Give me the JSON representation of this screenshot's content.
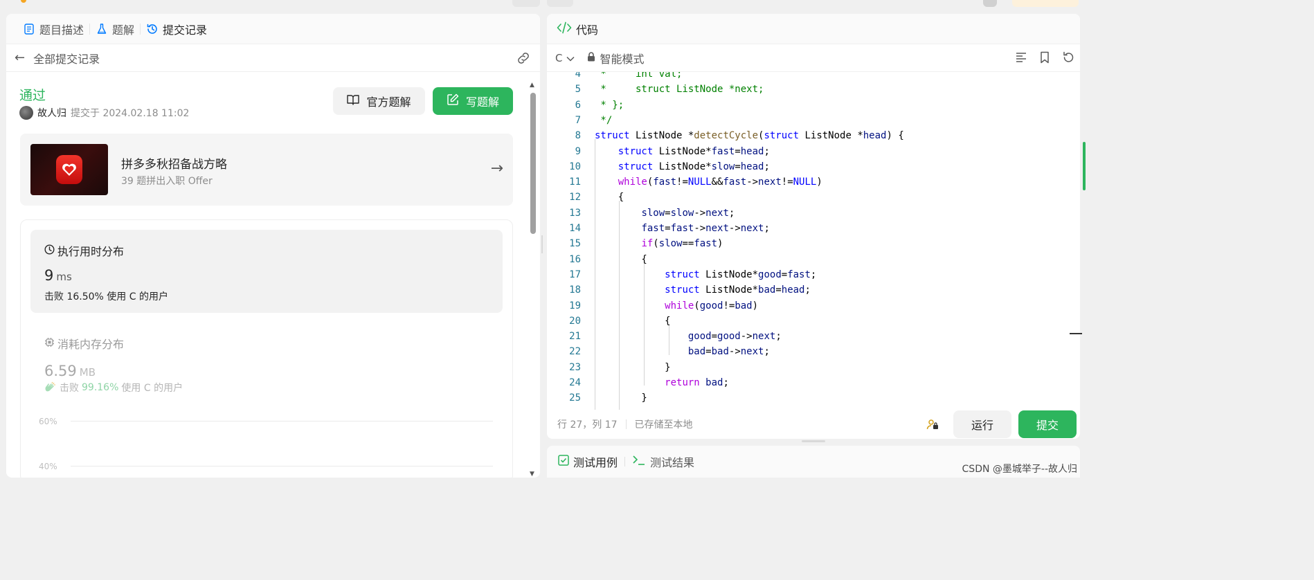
{
  "colors": {
    "accent_green": "#2db55d",
    "link_blue": "#007aff",
    "keyword_blue": "#0000ff",
    "keyword_purple": "#af00db",
    "line_number": "#237893"
  },
  "left_tabs": [
    {
      "label": "题目描述",
      "icon": "document-icon"
    },
    {
      "label": "题解",
      "icon": "flask-icon"
    },
    {
      "label": "提交记录",
      "icon": "history-icon"
    }
  ],
  "subheader": {
    "title": "全部提交记录",
    "back_icon": "arrow-left-icon",
    "share_icon": "link-icon"
  },
  "submission": {
    "status": "通过",
    "user": "故人归",
    "submitted_text": "提交于 2024.02.18 11:02",
    "official_solution_label": "官方题解",
    "write_solution_label": "写题解"
  },
  "promo": {
    "title": "拼多多秋招备战方略",
    "subtitle": "39 题拼出入职 Offer"
  },
  "runtime": {
    "title": "执行用时分布",
    "value": "9",
    "unit": "ms",
    "beats_prefix": "击败",
    "beats_pct": "16.50%",
    "beats_suffix": "使用 C 的用户"
  },
  "memory": {
    "title": "消耗内存分布",
    "value": "6.59",
    "unit": "MB",
    "beats_prefix": "击败",
    "beats_pct": "99.16%",
    "beats_suffix": "使用 C 的用户"
  },
  "chart_labels": [
    "60%",
    "40%"
  ],
  "editor_header": {
    "title": "代码",
    "language": "C",
    "mode": "智能模式"
  },
  "code_lines": [
    {
      "n": "4",
      "t": " *     int val;"
    },
    {
      "n": "5",
      "t": " *     struct ListNode *next;"
    },
    {
      "n": "6",
      "t": " * };"
    },
    {
      "n": "7",
      "t": " */"
    },
    {
      "n": "8",
      "t": "struct ListNode *detectCycle(struct ListNode *head) {"
    },
    {
      "n": "9",
      "t": "    struct ListNode*fast=head;"
    },
    {
      "n": "10",
      "t": "    struct ListNode*slow=head;"
    },
    {
      "n": "11",
      "t": "    while(fast!=NULL&&fast->next!=NULL)"
    },
    {
      "n": "12",
      "t": "    {"
    },
    {
      "n": "13",
      "t": "        slow=slow->next;"
    },
    {
      "n": "14",
      "t": "        fast=fast->next->next;"
    },
    {
      "n": "15",
      "t": "        if(slow==fast)"
    },
    {
      "n": "16",
      "t": "        {"
    },
    {
      "n": "17",
      "t": "            struct ListNode*good=fast;"
    },
    {
      "n": "18",
      "t": "            struct ListNode*bad=head;"
    },
    {
      "n": "19",
      "t": "            while(good!=bad)"
    },
    {
      "n": "20",
      "t": "            {"
    },
    {
      "n": "21",
      "t": "                good=good->next;"
    },
    {
      "n": "22",
      "t": "                bad=bad->next;"
    },
    {
      "n": "23",
      "t": "            }"
    },
    {
      "n": "24",
      "t": "            return bad;"
    },
    {
      "n": "25",
      "t": "        }"
    }
  ],
  "editor_footer": {
    "cursor": "行 27，列 17",
    "saved": "已存储至本地",
    "run_label": "运行",
    "submit_label": "提交"
  },
  "bottom_tabs": [
    {
      "label": "测试用例",
      "icon": "checkbox-icon"
    },
    {
      "label": "测试结果",
      "icon": "terminal-icon"
    }
  ],
  "watermark": "CSDN @墨城举子--故人归"
}
